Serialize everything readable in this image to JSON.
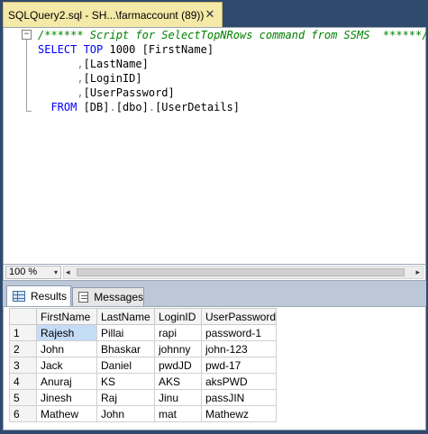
{
  "tab": {
    "title": "SQLQuery2.sql - SH...\\farmaccount (89))",
    "close_glyph": "✕"
  },
  "editor": {
    "collapse_glyph": "−",
    "lines": [
      {
        "indent": "",
        "comment": "/****** Script for SelectTopNRows command from SSMS  ******/"
      },
      {
        "kw1": "SELECT TOP",
        "num": " 1000 ",
        "col": "[FirstName]"
      },
      {
        "indent": "      ",
        "comma": ",",
        "col": "[LastName]"
      },
      {
        "indent": "      ",
        "comma": ",",
        "col": "[LoginID]"
      },
      {
        "indent": "      ",
        "comma": ",",
        "col": "[UserPassword]"
      },
      {
        "indent": "  ",
        "kw": "FROM",
        "db": " [DB]",
        "d1": ".",
        "schema": "[dbo]",
        "d2": ".",
        "table": "[UserDetails]"
      }
    ]
  },
  "zoom": {
    "value": "100 %",
    "arrow": "▾"
  },
  "scroll_glyphs": {
    "left": "◂",
    "right": "▸"
  },
  "results_tabs": {
    "results": "Results",
    "messages": "Messages"
  },
  "grid": {
    "columns": [
      "FirstName",
      "LastName",
      "LoginID",
      "UserPassword"
    ],
    "rows": [
      {
        "n": "1",
        "cells": [
          "Rajesh",
          "Pillai",
          "rapi",
          "password-1"
        ]
      },
      {
        "n": "2",
        "cells": [
          "John",
          "Bhaskar",
          "johnny",
          "john-123"
        ]
      },
      {
        "n": "3",
        "cells": [
          "Jack",
          "Daniel",
          "pwdJD",
          "pwd-17"
        ]
      },
      {
        "n": "4",
        "cells": [
          "Anuraj",
          "KS",
          "AKS",
          "aksPWD"
        ]
      },
      {
        "n": "5",
        "cells": [
          "Jinesh",
          "Raj",
          "Jinu",
          "passJIN"
        ]
      },
      {
        "n": "6",
        "cells": [
          "Mathew",
          "John",
          "mat",
          "Mathewz"
        ]
      }
    ]
  }
}
